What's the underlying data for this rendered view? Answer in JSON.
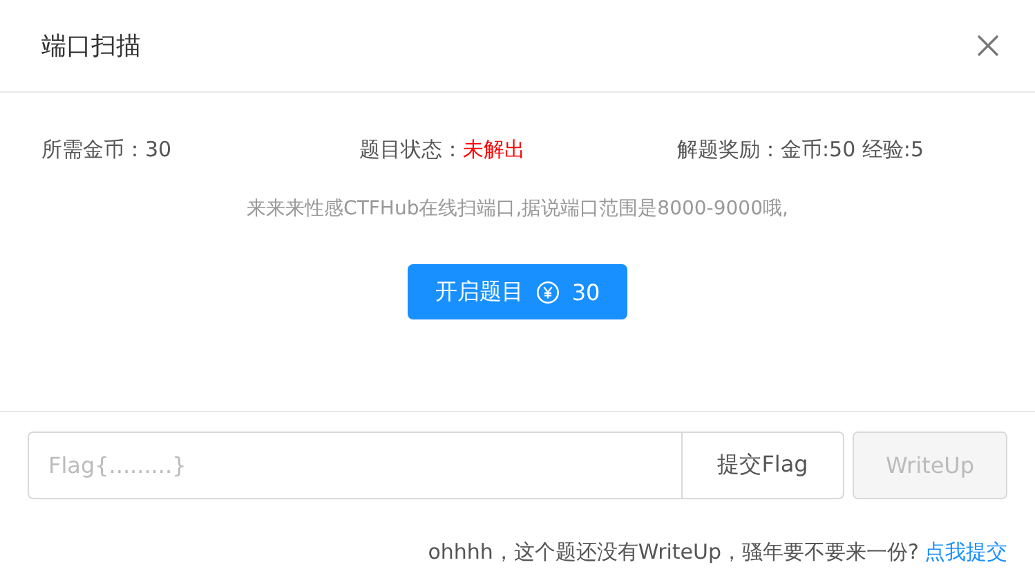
{
  "dialog": {
    "title": "端口扫描"
  },
  "info": [
    {
      "label": "所需金币：",
      "value": "30",
      "kind": "plain"
    },
    {
      "label": "题目状态：",
      "value": "未解出",
      "kind": "alert"
    },
    {
      "label": "解题奖励：",
      "value": "金币:50 经验:5",
      "kind": "plain"
    }
  ],
  "description": "来来来性感CTFHub在线扫端口,据说端口范围是8000-9000哦,",
  "start_button": {
    "label": "开启题目",
    "cost": "30"
  },
  "flag_input": {
    "placeholder": "Flag{.........}"
  },
  "submit_button": {
    "label": "提交Flag"
  },
  "writeup_button": {
    "label": "WriteUp",
    "disabled": true
  },
  "footer_note": {
    "text": "ohhhh，这个题还没有WriteUp，骚年要不要来一份?",
    "link": "点我提交"
  }
}
